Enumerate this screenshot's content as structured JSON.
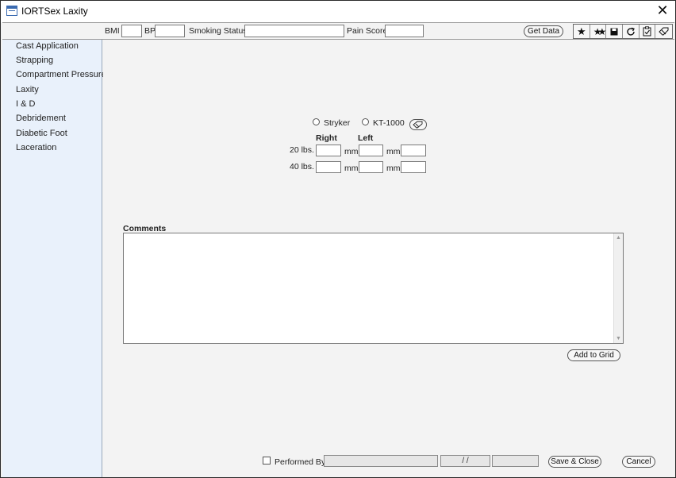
{
  "window": {
    "title": "IORTSex Laxity",
    "close_label": "✕"
  },
  "toolbar": {
    "bmi_label": "BMI",
    "bmi_value": "",
    "bp_label": "BP",
    "bp_value": "",
    "smoking_label": "Smoking Status",
    "smoking_value": "",
    "pain_label": "Pain Score",
    "pain_value": "",
    "get_data_label": "Get Data",
    "icons": [
      "star-icon",
      "double-star-icon",
      "save-icon",
      "refresh-icon",
      "clipboard-check-icon",
      "eraser-icon"
    ]
  },
  "sidebar": {
    "items": [
      {
        "label": "Cast Application"
      },
      {
        "label": "Strapping"
      },
      {
        "label": "Compartment Pressures"
      },
      {
        "label": "Laxity"
      },
      {
        "label": "I & D"
      },
      {
        "label": "Debridement"
      },
      {
        "label": "Diabetic Foot"
      },
      {
        "label": "Laceration"
      }
    ]
  },
  "laxity": {
    "option_stryker": "Stryker",
    "option_kt": "KT-1000",
    "col_right": "Right",
    "col_left": "Left",
    "row_20": "20 lbs.",
    "row_40": "40 lbs.",
    "unit_mm": "mm"
  },
  "comments": {
    "label": "Comments",
    "value": ""
  },
  "add_to_grid_label": "Add to Grid",
  "footer": {
    "performed_by_label": "Performed By",
    "performed_by_value": "",
    "date_value": "/ /",
    "time_value": "",
    "save_close_label": "Save & Close",
    "cancel_label": "Cancel"
  }
}
